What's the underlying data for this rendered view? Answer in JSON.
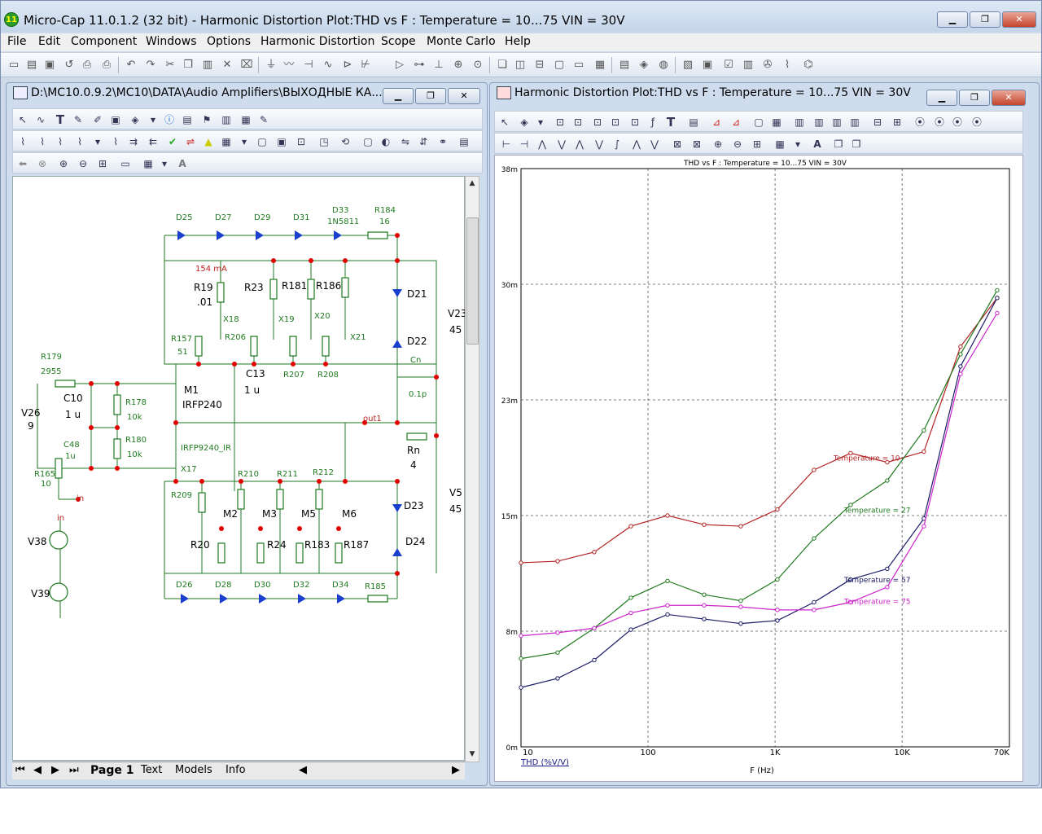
{
  "app": {
    "title": "Micro-Cap 11.0.1.2 (32 bit) - Harmonic Distortion Plot:THD vs F : Temperature = 10...75 VIN = 30V",
    "icon_label": "11",
    "window_controls": {
      "minimize": "▁",
      "maximize": "❐",
      "close": "✕"
    }
  },
  "menu": [
    "File",
    "Edit",
    "Component",
    "Windows",
    "Options",
    "Harmonic Distortion",
    "Scope",
    "Monte Carlo",
    "Help"
  ],
  "schematic_window": {
    "title": "D:\\MC10.0.9.2\\MC10\\DATA\\Audio Amplifiers\\ВЫХОДНЫЕ КА...",
    "tabs": [
      "Page 1",
      "Text",
      "Models",
      "Info"
    ],
    "labels": {
      "d25": "D25",
      "d27": "D27",
      "d29": "D29",
      "d31": "D31",
      "d33": "D33",
      "d33m": "1N5811",
      "r184": "R184",
      "r184v": "16",
      "ma": "154 mA",
      "r19": "R19",
      "r19v": ".01",
      "r23": "R23",
      "r181": "R181",
      "r186": "R186",
      "d21": "D21",
      "v23": "V23",
      "v23v": "45",
      "x18": "X18",
      "x19": "X19",
      "x20": "X20",
      "x21": "X21",
      "r157": "R157",
      "r157v": "51",
      "r206": "R206",
      "d22": "D22",
      "r207": "R207",
      "r208": "R208",
      "cn": "Cn",
      "cnv": "0.1p",
      "c13": "C13",
      "c13v": "1 u",
      "r179": "R179",
      "r179v": "2955",
      "c10": "C10",
      "c10v": "1 u",
      "r178": "R178",
      "r178v": "10k",
      "m1": "M1",
      "m1m": "IRFP240",
      "v26": "V26",
      "v26v": "9",
      "out1": "out1",
      "rn": "Rn",
      "rnv": "4",
      "c48": "C48",
      "c48v": "1u",
      "r180": "R180",
      "r180v": "10k",
      "irfp9240": "IRFP9240_IR",
      "x17": "X17",
      "r165": "R165",
      "r165v": "10",
      "in1": "in",
      "in2": "in",
      "r210": "R210",
      "r211": "R211",
      "r212": "R212",
      "r209": "R209",
      "m2": "M2",
      "m3": "M3",
      "m5": "M5",
      "m6": "M6",
      "d23": "D23",
      "v5": "V5",
      "v5v": "45",
      "r20": "R20",
      "r24": "R24",
      "r183": "R183",
      "r187": "R187",
      "d24": "D24",
      "v38": "V38",
      "v39": "V39",
      "d26": "D26",
      "d28": "D28",
      "d30": "D30",
      "d32": "D32",
      "d34": "D34",
      "r185": "R185"
    }
  },
  "plot_window": {
    "title": "Harmonic Distortion Plot:THD vs F : Temperature = 10...75 VIN = 30V"
  },
  "colors": {
    "temp10": "#b22222",
    "temp27": "#1f7a1f",
    "temp57": "#1a1a66",
    "temp75": "#cc22cc",
    "wire": "#1f7a1f",
    "diode": "#1a3fcf",
    "node": "#e00000"
  },
  "chart_data": {
    "type": "line",
    "title": "THD vs F : Temperature = 10...75 VIN = 30V",
    "xlabel": "F (Hz)",
    "ylabel": "THD (%V/V)",
    "xscale": "log",
    "xlim": [
      10,
      70000
    ],
    "ylim": [
      0,
      0.038
    ],
    "x_ticks": [
      "10",
      "100",
      "1K",
      "10K",
      "70K"
    ],
    "y_ticks": [
      "0m",
      "8m",
      "15m",
      "23m",
      "30m",
      "38m"
    ],
    "grid": true,
    "x": [
      10,
      16,
      25,
      40,
      63,
      100,
      160,
      250,
      400,
      630,
      1000,
      1600,
      2500,
      4000,
      6300,
      10000,
      16000,
      25000,
      40000,
      56000
    ],
    "series": [
      {
        "name": "Temperature = 10",
        "values": [
          0.0121,
          0.0122,
          0.0128,
          0.0145,
          0.0152,
          0.0146,
          0.0145,
          0.0156,
          0.0182,
          0.0193,
          0.0187,
          0.0194,
          0.0263,
          0.0295
        ]
      },
      {
        "name": "Temperature = 27",
        "values": [
          0.0058,
          0.0062,
          0.0078,
          0.0098,
          0.0109,
          0.01,
          0.0096,
          0.011,
          0.0137,
          0.0159,
          0.0175,
          0.0208,
          0.0258,
          0.03
        ]
      },
      {
        "name": "Temperature = 57",
        "values": [
          0.0039,
          0.0045,
          0.0057,
          0.0077,
          0.0087,
          0.0084,
          0.0081,
          0.0083,
          0.0095,
          0.011,
          0.0117,
          0.015,
          0.025,
          0.0295
        ]
      },
      {
        "name": "Temperature = 75",
        "values": [
          0.0073,
          0.0075,
          0.0078,
          0.0088,
          0.0093,
          0.0093,
          0.0092,
          0.009,
          0.009,
          0.0095,
          0.0105,
          0.0145,
          0.0245,
          0.0285
        ]
      }
    ]
  }
}
